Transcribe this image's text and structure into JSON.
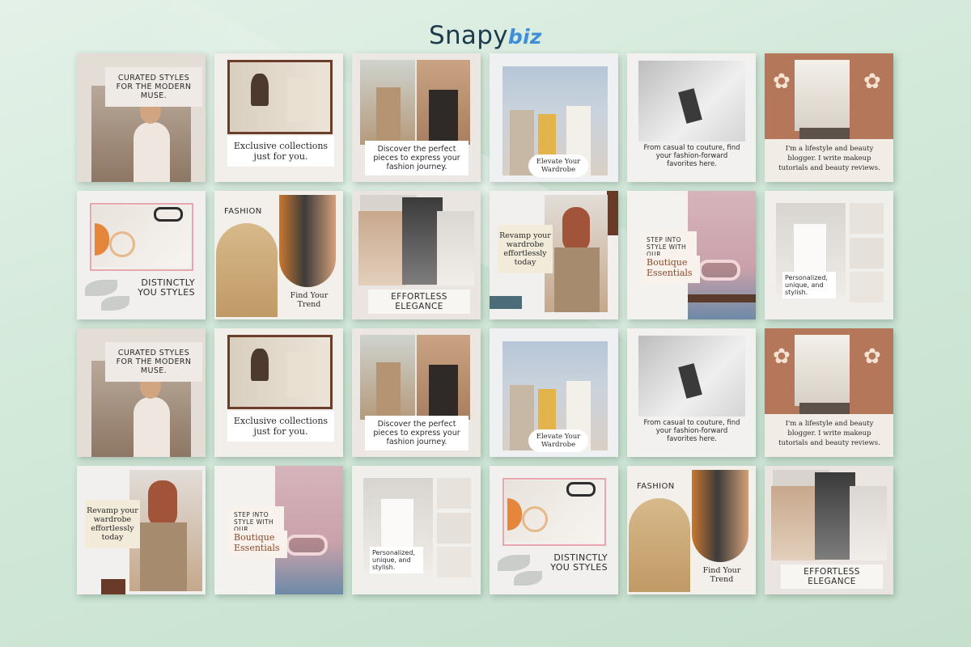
{
  "brand": {
    "name": "Snapy",
    "suffix": "biz"
  },
  "colors": {
    "background": "#d3e9da",
    "accent_brown": "#b5775a",
    "pink": "#e8a6ae",
    "brown_dark": "#6a3a28"
  },
  "cards": {
    "curated_1": {
      "text": "CURATED STYLES FOR THE MODERN MUSE."
    },
    "exclusive_1": {
      "text": "Exclusive collections just for you."
    },
    "discover_1": {
      "text": "Discover the perfect pieces to express your fashion journey."
    },
    "elevate_1": {
      "text": "Elevate Your Wardrobe"
    },
    "casual_1": {
      "text": "From casual to couture, find your fashion-forward favorites here."
    },
    "blogger_1": {
      "text": "I'm a lifestyle and beauty blogger. I write makeup tutorials and beauty reviews."
    },
    "distinct_1": {
      "text": "DISTINCTLY YOU STYLES"
    },
    "fashion_1": {
      "tag": "FASHION",
      "text": "Find Your Trend"
    },
    "effortless_1": {
      "text": "EFFORTLESS ELEGANCE"
    },
    "revamp_1": {
      "text": "Revamp your wardrobe effortlessly today"
    },
    "boutique_1": {
      "small": "STEP INTO STYLE WITH OUR",
      "big": "Boutique Essentials"
    },
    "personalized_1": {
      "text": "Personalized, unique, and stylish."
    },
    "curated_2": {
      "text": "CURATED STYLES FOR THE MODERN MUSE."
    },
    "exclusive_2": {
      "text": "Exclusive collections just for you."
    },
    "discover_2": {
      "text": "Discover the perfect pieces to express your fashion journey."
    },
    "elevate_2": {
      "text": "Elevate Your Wardrobe"
    },
    "casual_2": {
      "text": "From casual to couture, find your fashion-forward favorites here."
    },
    "blogger_2": {
      "text": "I'm a lifestyle and beauty blogger. I write makeup tutorials and beauty reviews."
    },
    "revamp_2": {
      "text": "Revamp your wardrobe effortlessly today"
    },
    "boutique_2": {
      "small": "STEP INTO STYLE WITH OUR",
      "big": "Boutique Essentials"
    },
    "personalized_2": {
      "text": "Personalized, unique, and stylish."
    },
    "distinct_2": {
      "text": "DISTINCTLY YOU STYLES"
    },
    "fashion_2": {
      "tag": "FASHION",
      "text": "Find Your Trend"
    },
    "effortless_2": {
      "text": "EFFORTLESS ELEGANCE"
    }
  }
}
